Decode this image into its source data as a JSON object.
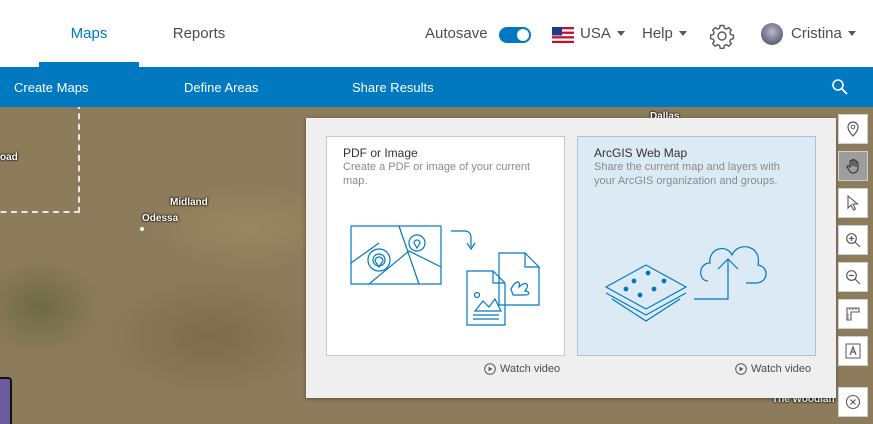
{
  "header": {
    "tabs": [
      {
        "label": "Maps",
        "active": true
      },
      {
        "label": "Reports",
        "active": false
      }
    ],
    "autosave_label": "Autosave",
    "autosave_on": true,
    "country_label": "USA",
    "help_label": "Help",
    "user_name": "Cristina",
    "accent_color": "#0079c1"
  },
  "nav": {
    "items": [
      {
        "label": "Create Maps"
      },
      {
        "label": "Define Areas"
      },
      {
        "label": "Share Results"
      }
    ]
  },
  "map": {
    "labels": [
      "Dallas",
      "Midland",
      "Odessa",
      "oad",
      "The Woodlan"
    ]
  },
  "share_panel": {
    "cards": [
      {
        "title": "PDF or Image",
        "description": "Create a PDF or image of your current map.",
        "selected": false,
        "watch_label": "Watch video"
      },
      {
        "title": "ArcGIS Web Map",
        "description": "Share the current map and layers with your ArcGIS organization and groups.",
        "selected": true,
        "watch_label": "Watch video"
      }
    ]
  },
  "toolbar": {
    "buttons": [
      {
        "icon": "map-pin-icon",
        "active": false
      },
      {
        "icon": "pan-hand-icon",
        "active": true
      },
      {
        "icon": "select-arrow-icon",
        "active": false
      },
      {
        "icon": "zoom-in-icon",
        "active": false
      },
      {
        "icon": "zoom-out-icon",
        "active": false
      },
      {
        "icon": "measure-icon",
        "active": false
      },
      {
        "icon": "text-annotation-icon",
        "active": false
      },
      {
        "icon": "clear-icon",
        "active": false
      }
    ]
  }
}
